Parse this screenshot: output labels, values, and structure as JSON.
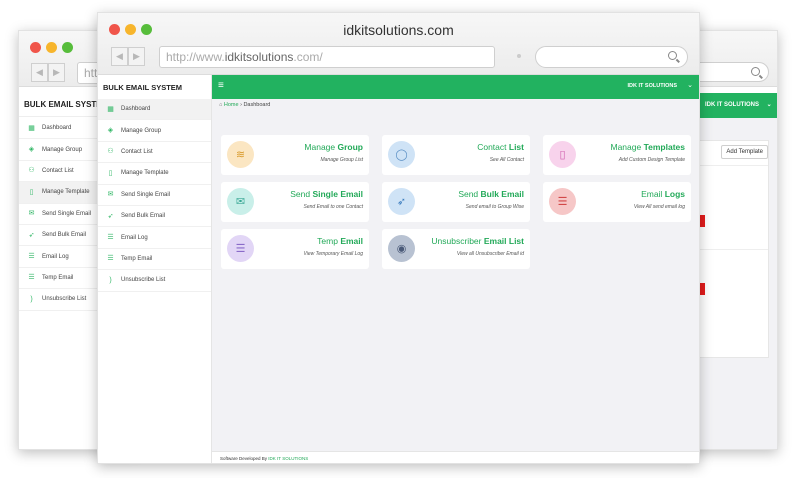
{
  "left_window": {
    "url_partial": "htt",
    "brand": "BULK EMAIL SYSTEM",
    "items": [
      {
        "label": "Dashboard",
        "icon": "calendar-icon"
      },
      {
        "label": "Manage Group",
        "icon": "layers-icon"
      },
      {
        "label": "Contact List",
        "icon": "user-icon"
      },
      {
        "label": "Manage Template",
        "icon": "file-icon"
      },
      {
        "label": "Send Single Email",
        "icon": "mail-icon"
      },
      {
        "label": "Send Bulk Email",
        "icon": "rocket-icon"
      },
      {
        "label": "Email Log",
        "icon": "list-icon"
      },
      {
        "label": "Temp Email",
        "icon": "list-icon"
      },
      {
        "label": "Unsubscribe List",
        "icon": "rss-icon"
      }
    ],
    "active_index": 3
  },
  "right_window": {
    "header_brand": "IDK IT SOLUTIONS",
    "add_button": "Add Template"
  },
  "main_window": {
    "title": "idkitsolutions.com",
    "url_prefix": "http://www.",
    "url_domain": "idkitsolutions",
    "url_suffix": ".com/",
    "brand": "BULK EMAIL SYSTEM",
    "menu_icon": "≡",
    "header_brand": "IDK IT SOLUTIONS",
    "breadcrumb_home": "Home",
    "breadcrumb_sep": "›",
    "breadcrumb_current": "Dashboard",
    "sidebar": [
      {
        "label": "Dashboard",
        "icon": "calendar-icon"
      },
      {
        "label": "Manage Group",
        "icon": "layers-icon"
      },
      {
        "label": "Contact List",
        "icon": "user-icon"
      },
      {
        "label": "Manage Template",
        "icon": "file-icon"
      },
      {
        "label": "Send Single Email",
        "icon": "mail-icon"
      },
      {
        "label": "Send Bulk Email",
        "icon": "rocket-icon"
      },
      {
        "label": "Email Log",
        "icon": "list-icon"
      },
      {
        "label": "Temp Email",
        "icon": "list-icon"
      },
      {
        "label": "Unsubscribe List",
        "icon": "rss-icon"
      }
    ],
    "active_index": 0,
    "cards": [
      {
        "t1": "Manage ",
        "t2": "Group",
        "sub": "Manage Group List",
        "icon": "layers-icon",
        "glyph": "≋",
        "bg": "#fbe6c2",
        "fg": "#d89a2c"
      },
      {
        "t1": "Contact ",
        "t2": "List",
        "sub": "See All Contact",
        "icon": "user-icon",
        "glyph": "◯",
        "bg": "#cfe3f6",
        "fg": "#5a8fc4"
      },
      {
        "t1": "Manage ",
        "t2": "Templates",
        "sub": "Add Custom Design Template",
        "icon": "file-icon",
        "glyph": "▯",
        "bg": "#f8d3ec",
        "fg": "#d15fae"
      },
      {
        "t1": "Send ",
        "t2": "Single Email",
        "sub": "Send Email to one Contact",
        "icon": "mail-icon",
        "glyph": "✉",
        "bg": "#c9efe9",
        "fg": "#39a895"
      },
      {
        "t1": "Send ",
        "t2": "Bulk Email",
        "sub": "Send email to Group Wise",
        "icon": "rocket-icon",
        "glyph": "➶",
        "bg": "#cfe3f6",
        "fg": "#3f7fbf"
      },
      {
        "t1": "Email ",
        "t2": "Logs",
        "sub": "View All send email log",
        "icon": "list-icon",
        "glyph": "☰",
        "bg": "#f6c7c7",
        "fg": "#d24848"
      },
      {
        "t1": "Temp ",
        "t2": "Email",
        "sub": "View Temporary Email Log",
        "icon": "list-icon",
        "glyph": "☰",
        "bg": "#e2d6f6",
        "fg": "#8a6bc9"
      },
      {
        "t1": "Unsubscriber ",
        "t2": "Email List",
        "sub": "View all Unsubscriber Email id",
        "icon": "rss-icon",
        "glyph": "◉",
        "bg": "#b8c2d2",
        "fg": "#4a5a78"
      }
    ],
    "footer_text": "Software Developed By ",
    "footer_link": "IDK IT SOLUTIONS"
  },
  "colors": {
    "accent": "#22b260",
    "title_green": "#22a958"
  }
}
